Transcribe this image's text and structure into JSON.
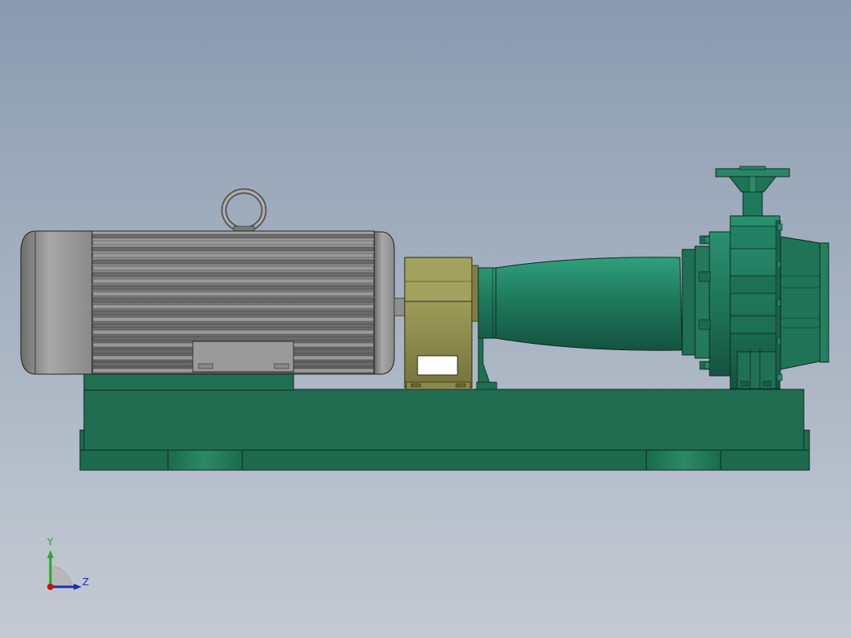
{
  "view": {
    "colors": {
      "background_top": "#8a9bb0",
      "background_bottom": "#c4cad3",
      "pump_green": "#1f6e52",
      "motor_gray": "#8c8c8c",
      "bracket_olive": "#8a8a4a"
    }
  },
  "triad": {
    "y_label": "Y",
    "z_label": "Z",
    "y_color": "#22aa22",
    "z_color": "#1a2fb0",
    "x_color": "#cc1111"
  }
}
